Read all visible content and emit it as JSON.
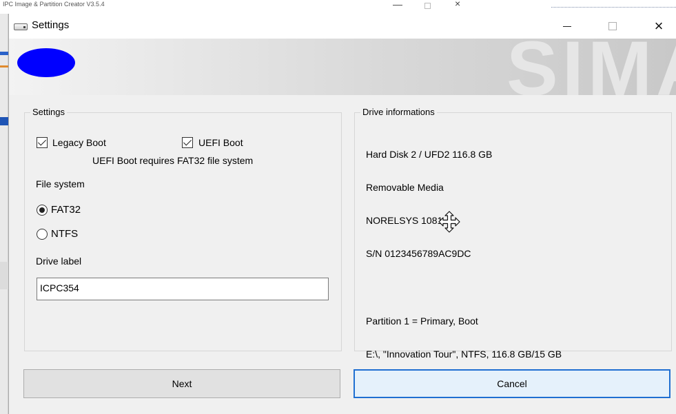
{
  "background_app": {
    "title": "IPC Image & Partition Creator V3.5.4",
    "min": "—",
    "close": "×"
  },
  "window": {
    "title": "Settings",
    "icon": "drive-icon",
    "controls": {
      "min": "minimize-icon",
      "max": "maximize-icon",
      "close": "×"
    }
  },
  "banner": {
    "logo": "blue-oval-logo",
    "watermark": "SIMA",
    "colors": {
      "logo": "#0000ff"
    }
  },
  "settings": {
    "legend": "Settings",
    "legacy_boot": {
      "label": "Legacy Boot",
      "checked": true
    },
    "uefi_boot": {
      "label": "UEFI Boot",
      "checked": true
    },
    "uefi_note": "UEFI Boot requires FAT32 file system",
    "file_system_label": "File system",
    "fs_options": [
      {
        "label": "FAT32",
        "selected": true
      },
      {
        "label": "NTFS",
        "selected": false
      }
    ],
    "drive_label_title": "Drive label",
    "drive_label_value": "ICPC354"
  },
  "drive_info": {
    "legend": "Drive informations",
    "line1": "Hard Disk 2 / UFD2 116.8 GB",
    "line2": "Removable Media",
    "line3": "NORELSYS 1081",
    "line4": "S/N 0123456789AC9DC",
    "line5": "Partition 1 = Primary, Boot",
    "line6": "E:\\, \"Innovation Tour\", NTFS, 116.8 GB/15 GB"
  },
  "buttons": {
    "next": "Next",
    "cancel": "Cancel"
  },
  "colors": {
    "accent_focus": "#1f6fd1",
    "dialog_bg": "#f0f0f0"
  }
}
